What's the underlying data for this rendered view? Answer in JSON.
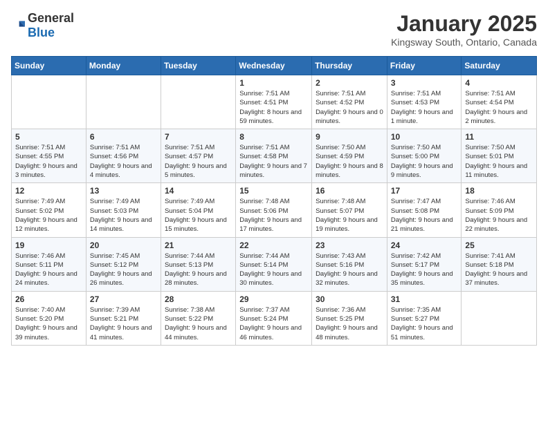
{
  "logo": {
    "general": "General",
    "blue": "Blue"
  },
  "title": "January 2025",
  "location": "Kingsway South, Ontario, Canada",
  "weekdays": [
    "Sunday",
    "Monday",
    "Tuesday",
    "Wednesday",
    "Thursday",
    "Friday",
    "Saturday"
  ],
  "weeks": [
    [
      {
        "day": "",
        "sunrise": "",
        "sunset": "",
        "daylight": ""
      },
      {
        "day": "",
        "sunrise": "",
        "sunset": "",
        "daylight": ""
      },
      {
        "day": "",
        "sunrise": "",
        "sunset": "",
        "daylight": ""
      },
      {
        "day": "1",
        "sunrise": "Sunrise: 7:51 AM",
        "sunset": "Sunset: 4:51 PM",
        "daylight": "Daylight: 8 hours and 59 minutes."
      },
      {
        "day": "2",
        "sunrise": "Sunrise: 7:51 AM",
        "sunset": "Sunset: 4:52 PM",
        "daylight": "Daylight: 9 hours and 0 minutes."
      },
      {
        "day": "3",
        "sunrise": "Sunrise: 7:51 AM",
        "sunset": "Sunset: 4:53 PM",
        "daylight": "Daylight: 9 hours and 1 minute."
      },
      {
        "day": "4",
        "sunrise": "Sunrise: 7:51 AM",
        "sunset": "Sunset: 4:54 PM",
        "daylight": "Daylight: 9 hours and 2 minutes."
      }
    ],
    [
      {
        "day": "5",
        "sunrise": "Sunrise: 7:51 AM",
        "sunset": "Sunset: 4:55 PM",
        "daylight": "Daylight: 9 hours and 3 minutes."
      },
      {
        "day": "6",
        "sunrise": "Sunrise: 7:51 AM",
        "sunset": "Sunset: 4:56 PM",
        "daylight": "Daylight: 9 hours and 4 minutes."
      },
      {
        "day": "7",
        "sunrise": "Sunrise: 7:51 AM",
        "sunset": "Sunset: 4:57 PM",
        "daylight": "Daylight: 9 hours and 5 minutes."
      },
      {
        "day": "8",
        "sunrise": "Sunrise: 7:51 AM",
        "sunset": "Sunset: 4:58 PM",
        "daylight": "Daylight: 9 hours and 7 minutes."
      },
      {
        "day": "9",
        "sunrise": "Sunrise: 7:50 AM",
        "sunset": "Sunset: 4:59 PM",
        "daylight": "Daylight: 9 hours and 8 minutes."
      },
      {
        "day": "10",
        "sunrise": "Sunrise: 7:50 AM",
        "sunset": "Sunset: 5:00 PM",
        "daylight": "Daylight: 9 hours and 9 minutes."
      },
      {
        "day": "11",
        "sunrise": "Sunrise: 7:50 AM",
        "sunset": "Sunset: 5:01 PM",
        "daylight": "Daylight: 9 hours and 11 minutes."
      }
    ],
    [
      {
        "day": "12",
        "sunrise": "Sunrise: 7:49 AM",
        "sunset": "Sunset: 5:02 PM",
        "daylight": "Daylight: 9 hours and 12 minutes."
      },
      {
        "day": "13",
        "sunrise": "Sunrise: 7:49 AM",
        "sunset": "Sunset: 5:03 PM",
        "daylight": "Daylight: 9 hours and 14 minutes."
      },
      {
        "day": "14",
        "sunrise": "Sunrise: 7:49 AM",
        "sunset": "Sunset: 5:04 PM",
        "daylight": "Daylight: 9 hours and 15 minutes."
      },
      {
        "day": "15",
        "sunrise": "Sunrise: 7:48 AM",
        "sunset": "Sunset: 5:06 PM",
        "daylight": "Daylight: 9 hours and 17 minutes."
      },
      {
        "day": "16",
        "sunrise": "Sunrise: 7:48 AM",
        "sunset": "Sunset: 5:07 PM",
        "daylight": "Daylight: 9 hours and 19 minutes."
      },
      {
        "day": "17",
        "sunrise": "Sunrise: 7:47 AM",
        "sunset": "Sunset: 5:08 PM",
        "daylight": "Daylight: 9 hours and 21 minutes."
      },
      {
        "day": "18",
        "sunrise": "Sunrise: 7:46 AM",
        "sunset": "Sunset: 5:09 PM",
        "daylight": "Daylight: 9 hours and 22 minutes."
      }
    ],
    [
      {
        "day": "19",
        "sunrise": "Sunrise: 7:46 AM",
        "sunset": "Sunset: 5:11 PM",
        "daylight": "Daylight: 9 hours and 24 minutes."
      },
      {
        "day": "20",
        "sunrise": "Sunrise: 7:45 AM",
        "sunset": "Sunset: 5:12 PM",
        "daylight": "Daylight: 9 hours and 26 minutes."
      },
      {
        "day": "21",
        "sunrise": "Sunrise: 7:44 AM",
        "sunset": "Sunset: 5:13 PM",
        "daylight": "Daylight: 9 hours and 28 minutes."
      },
      {
        "day": "22",
        "sunrise": "Sunrise: 7:44 AM",
        "sunset": "Sunset: 5:14 PM",
        "daylight": "Daylight: 9 hours and 30 minutes."
      },
      {
        "day": "23",
        "sunrise": "Sunrise: 7:43 AM",
        "sunset": "Sunset: 5:16 PM",
        "daylight": "Daylight: 9 hours and 32 minutes."
      },
      {
        "day": "24",
        "sunrise": "Sunrise: 7:42 AM",
        "sunset": "Sunset: 5:17 PM",
        "daylight": "Daylight: 9 hours and 35 minutes."
      },
      {
        "day": "25",
        "sunrise": "Sunrise: 7:41 AM",
        "sunset": "Sunset: 5:18 PM",
        "daylight": "Daylight: 9 hours and 37 minutes."
      }
    ],
    [
      {
        "day": "26",
        "sunrise": "Sunrise: 7:40 AM",
        "sunset": "Sunset: 5:20 PM",
        "daylight": "Daylight: 9 hours and 39 minutes."
      },
      {
        "day": "27",
        "sunrise": "Sunrise: 7:39 AM",
        "sunset": "Sunset: 5:21 PM",
        "daylight": "Daylight: 9 hours and 41 minutes."
      },
      {
        "day": "28",
        "sunrise": "Sunrise: 7:38 AM",
        "sunset": "Sunset: 5:22 PM",
        "daylight": "Daylight: 9 hours and 44 minutes."
      },
      {
        "day": "29",
        "sunrise": "Sunrise: 7:37 AM",
        "sunset": "Sunset: 5:24 PM",
        "daylight": "Daylight: 9 hours and 46 minutes."
      },
      {
        "day": "30",
        "sunrise": "Sunrise: 7:36 AM",
        "sunset": "Sunset: 5:25 PM",
        "daylight": "Daylight: 9 hours and 48 minutes."
      },
      {
        "day": "31",
        "sunrise": "Sunrise: 7:35 AM",
        "sunset": "Sunset: 5:27 PM",
        "daylight": "Daylight: 9 hours and 51 minutes."
      },
      {
        "day": "",
        "sunrise": "",
        "sunset": "",
        "daylight": ""
      }
    ]
  ]
}
